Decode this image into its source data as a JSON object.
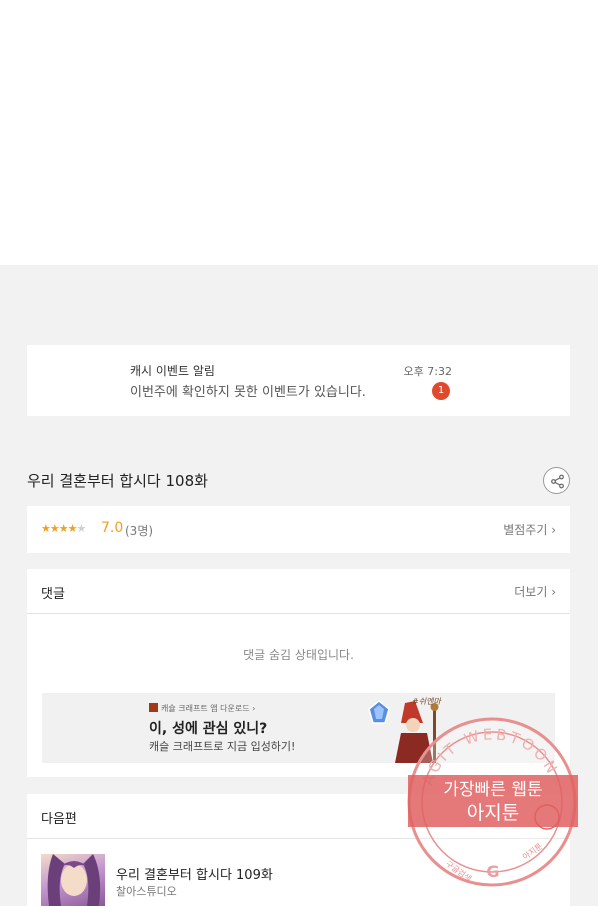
{
  "notification": {
    "title": "캐시 이벤트 알림",
    "message": "이번주에 확인하지 못한 이벤트가 있습니다.",
    "time": "오후 7:32",
    "badge": "1"
  },
  "episode": {
    "title": "우리 결혼부터 합시다 108화"
  },
  "rating": {
    "score": "7.0",
    "count": "(3명)",
    "stars_filled": 3.5,
    "stars_total": 5,
    "rate_label": "별점주기 ›"
  },
  "comments": {
    "label": "댓글",
    "more_label": "더보기 ›",
    "hidden_notice": "댓글 숨김 상태입니다."
  },
  "ad": {
    "top_line": "캐슐 크래프트 앱 다운로드 ›",
    "headline": "이, 성에 관심 있니?",
    "subline": "캐슬 크래프트로 지금 입성하기!",
    "art_caption": "#쉬엔마"
  },
  "next": {
    "label": "다음편",
    "item_title": "우리 결혼부터 합시다 109화",
    "item_studio": "찰아스튜디오"
  },
  "watermark": {
    "ring_text": "AGIT WEBTOON",
    "line1": "가장빠른 웹툰",
    "line2": "아지툰",
    "bottom_left": "구글검색",
    "bottom_right": "아지툰",
    "color": "#e06060"
  },
  "colors": {
    "accent": "#f0a020",
    "badge": "#e0492b"
  }
}
